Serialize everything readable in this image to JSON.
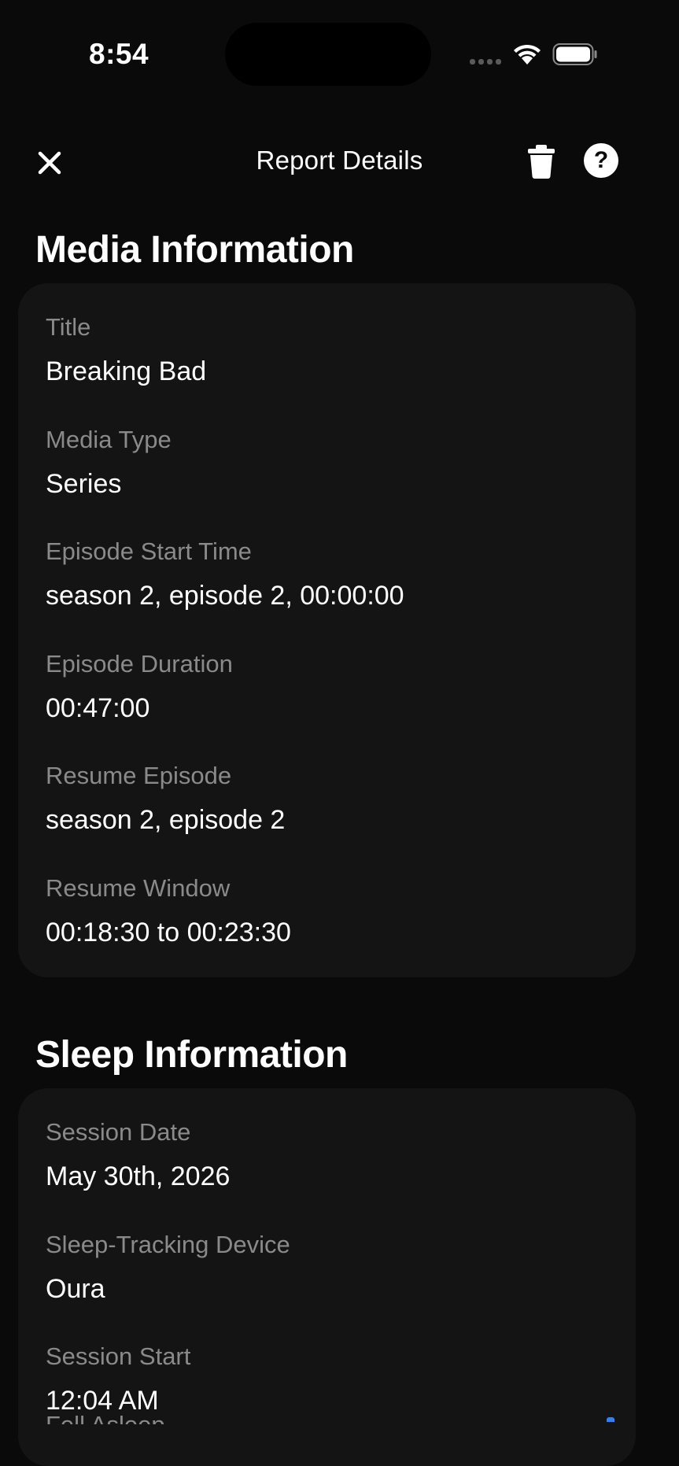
{
  "status_bar": {
    "time": "8:54",
    "icons": [
      "cellular-signal-icon",
      "wifi-icon",
      "battery-icon"
    ]
  },
  "nav": {
    "title": "Report Details",
    "close_icon": "close-icon",
    "delete_icon": "trash-icon",
    "help_label": "?"
  },
  "media": {
    "heading": "Media Information",
    "fields": [
      {
        "label": "Title",
        "value": "Breaking Bad"
      },
      {
        "label": "Media Type",
        "value": "Series"
      },
      {
        "label": "Episode Start Time",
        "value": "season 2, episode 2, 00:00:00"
      },
      {
        "label": "Episode Duration",
        "value": "00:47:00"
      },
      {
        "label": "Resume Episode",
        "value": "season 2, episode 2"
      },
      {
        "label": "Resume Window",
        "value": "00:18:30 to 00:23:30"
      }
    ]
  },
  "sleep": {
    "heading": "Sleep Information",
    "fields": [
      {
        "label": "Session Date",
        "value": "May 30th, 2026"
      },
      {
        "label": "Sleep-Tracking Device",
        "value": "Oura"
      },
      {
        "label": "Session Start",
        "value": "12:04 AM"
      }
    ],
    "partial_label": "Fell Asleep"
  },
  "colors": {
    "background": "#0a0a0a",
    "card": "#141414",
    "label": "#8a8a8a",
    "accent": "#2f7ff5"
  }
}
